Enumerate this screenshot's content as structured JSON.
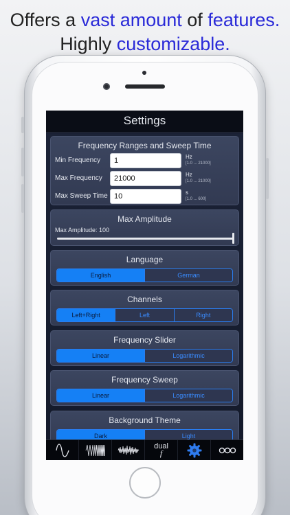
{
  "promo": {
    "line1": [
      "Offers a ",
      "vast amount",
      " of ",
      "features."
    ],
    "line2": [
      "Highly ",
      "customizable."
    ]
  },
  "colors": {
    "accent": "#1580f5",
    "headline_highlight": "#2a2ad8",
    "card_bg": "#363f58",
    "screen_bg": "#141a2b"
  },
  "screen": {
    "title": "Settings",
    "frequency_section": {
      "title": "Frequency Ranges and Sweep Time",
      "fields": [
        {
          "label": "Min Frequency",
          "value": "1",
          "unit": "Hz",
          "range": "[1.0 ... 21000]"
        },
        {
          "label": "Max Frequency",
          "value": "21000",
          "unit": "Hz",
          "range": "[1.0 ... 21000]"
        },
        {
          "label": "Max Sweep Time",
          "value": "10",
          "unit": "s",
          "range": "[1.0 ... 600]"
        }
      ]
    },
    "amplitude_section": {
      "title": "Max Amplitude",
      "label": "Max Amplitude: 100",
      "value_fraction": 1.0
    },
    "language_section": {
      "title": "Language",
      "options": [
        "English",
        "German"
      ],
      "selected": "English"
    },
    "channels_section": {
      "title": "Channels",
      "options": [
        "Left+Right",
        "Left",
        "Right"
      ],
      "selected": "Left+Right"
    },
    "slider_section": {
      "title": "Frequency Slider",
      "options": [
        "Linear",
        "Logarithmic"
      ],
      "selected": "Linear"
    },
    "sweep_section": {
      "title": "Frequency Sweep",
      "options": [
        "Linear",
        "Logarithmic"
      ],
      "selected": "Linear"
    },
    "theme_section": {
      "title": "Background Theme",
      "options": [
        "Dark",
        "Light"
      ],
      "selected": "Dark"
    },
    "tab_bar": {
      "tabs": [
        {
          "icon": "sine-wave-icon"
        },
        {
          "icon": "sweep-wave-icon"
        },
        {
          "icon": "noise-wave-icon"
        },
        {
          "icon": "dual-frequency-icon",
          "label_top": "dual",
          "label_bottom": "f"
        },
        {
          "icon": "gear-icon",
          "active": true
        },
        {
          "icon": "more-icon"
        }
      ]
    }
  }
}
